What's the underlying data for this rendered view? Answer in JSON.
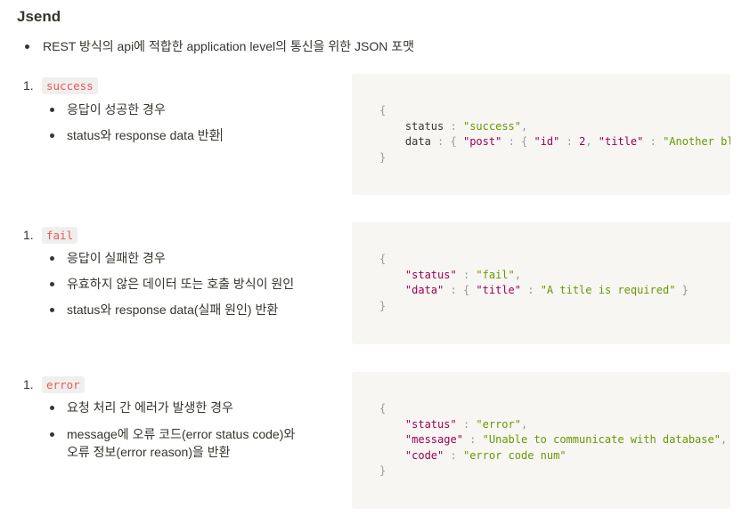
{
  "page": {
    "title": "Jsend",
    "intro": "REST 방식의 api에 적합한 application level의 통신을 위한 JSON 포맷"
  },
  "sections": [
    {
      "number": "1.",
      "tag": "success",
      "bullets": [
        "응답이 성공한 경우",
        "status와 response data 반환"
      ],
      "code": {
        "open": "{",
        "l1_key": "status",
        "l1_val": "\"success\"",
        "l2_key": "data",
        "l2_k1": "\"post\"",
        "l2_k2": "\"id\"",
        "l2_v2": "2",
        "l2_k3": "\"title\"",
        "l2_v3": "\"Another bl",
        "close": "}"
      }
    },
    {
      "number": "1.",
      "tag": "fail",
      "bullets": [
        "응답이 실패한 경우",
        "유효하지 않은 데이터 또는 호출 방식이 원인",
        "status와 response data(실패 원인) 반환"
      ],
      "code": {
        "open": "{",
        "l1_key": "\"status\"",
        "l1_val": "\"fail\"",
        "l2_key": "\"data\"",
        "l2_k1": "\"title\"",
        "l2_v1": "\"A title is required\"",
        "close": "}"
      }
    },
    {
      "number": "1.",
      "tag": "error",
      "bullets": [
        "요청 처리 간 에러가 발생한 경우",
        "message에 오류 코드(error status code)와",
        "오류 정보(error reason)을 반환"
      ],
      "code": {
        "open": "{",
        "l1_key": "\"status\"",
        "l1_val": "\"error\"",
        "l2_key": "\"message\"",
        "l2_val": "\"Unable to communicate with database\"",
        "l3_key": "\"code\"",
        "l3_val": "\"error code num\"",
        "close": "}"
      }
    }
  ],
  "colors": {
    "text": "#37352f",
    "inline_code": "#eb5757",
    "code_bg": "#f7f6f3",
    "key": "#990055",
    "string": "#669900"
  }
}
